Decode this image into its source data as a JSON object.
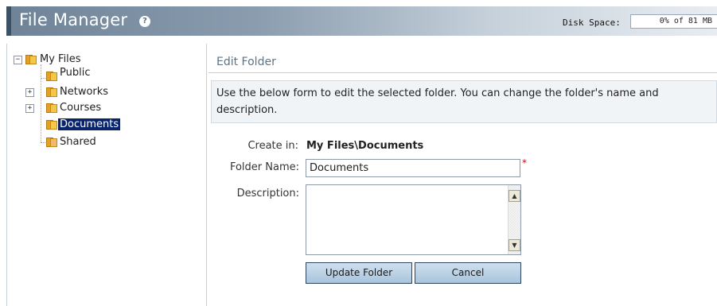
{
  "header": {
    "title": "File Manager",
    "help_glyph": "?",
    "disk_label": "Disk Space:",
    "disk_value": "0% of 81 MB"
  },
  "tree": {
    "root": "My Files",
    "items": [
      {
        "label": "Public",
        "icon": "folder-icon"
      },
      {
        "label": "Networks",
        "icon": "folder-icon",
        "expander": "+"
      },
      {
        "label": "Courses",
        "icon": "folder-icon",
        "expander": "+"
      },
      {
        "label": "Documents",
        "icon": "folder-icon",
        "selected": true
      },
      {
        "label": "Shared",
        "icon": "shared-folder-icon"
      }
    ],
    "root_expander": "−"
  },
  "content": {
    "title": "Edit Folder",
    "info": "Use the below form to edit the selected folder. You can change the folder's name and description.",
    "create_in_label": "Create in:",
    "create_in_value": "My Files\\Documents",
    "folder_name_label": "Folder Name:",
    "folder_name_value": "Documents",
    "required_mark": "*",
    "description_label": "Description:",
    "description_value": "",
    "update_button": "Update Folder",
    "cancel_button": "Cancel"
  },
  "colors": {
    "header_dark": "#3e5063",
    "section_title": "#5b7389",
    "selection": "#0a246a",
    "required": "#dd0000"
  }
}
